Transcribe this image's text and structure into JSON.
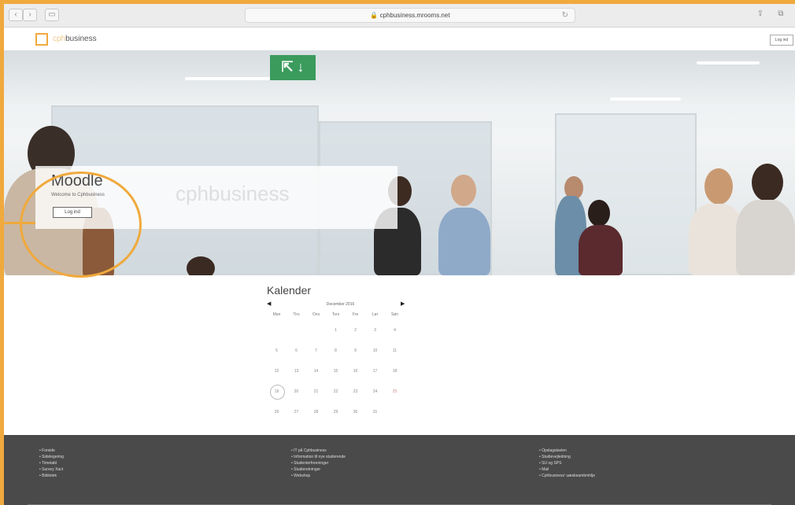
{
  "browser": {
    "url": "cphbusiness.mrooms.net"
  },
  "site": {
    "logo_text_light": "cph",
    "logo_text": "business",
    "login_top_label": "Log ind"
  },
  "hero": {
    "title": "Moodle",
    "subtitle": "Welcome to Cphbusiness",
    "login_label": "Log ind",
    "watermark": "cphbusiness",
    "exit_sign": "⇱ ↓"
  },
  "calendar": {
    "title": "Kalender",
    "month": "December 2016",
    "prev": "◀",
    "next": "▶",
    "weekdays": [
      "Man",
      "Tirs",
      "Ons",
      "Tors",
      "Fre",
      "Lør",
      "Søn"
    ],
    "weeks": [
      [
        "",
        "",
        "",
        "1",
        "2",
        "3",
        "4"
      ],
      [
        "5",
        "6",
        "7",
        "8",
        "9",
        "10",
        "11"
      ],
      [
        "12",
        "13",
        "14",
        "15",
        "16",
        "17",
        "18"
      ],
      [
        "19",
        "20",
        "21",
        "22",
        "23",
        "24",
        "25"
      ],
      [
        "26",
        "27",
        "28",
        "29",
        "30",
        "31",
        ""
      ]
    ],
    "today": "19"
  },
  "footer": {
    "col1": [
      "Forside",
      "Sidelegering",
      "Timetabl",
      "Survey Xact",
      "Bibliotek"
    ],
    "col2": [
      "IT på Cphbusiness",
      "Information til nye studerende",
      "Studenterforeninger",
      "Studieretninger",
      "Webshop"
    ],
    "col3": [
      "Opslagstavlen",
      "Studievejledning",
      "SU og SPS",
      "Mail",
      "Cphbusiness' uæskeambmhlje"
    ]
  }
}
